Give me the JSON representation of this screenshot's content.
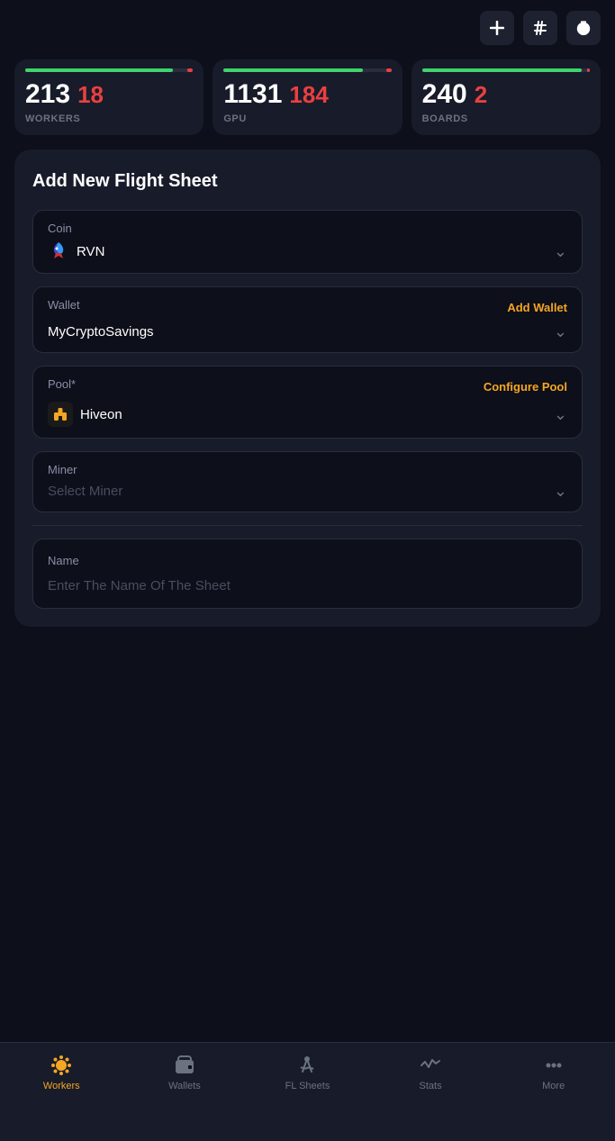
{
  "topbar": {
    "add_label": "+",
    "hash_label": "#",
    "timer_label": "⏱"
  },
  "stats": {
    "workers": {
      "main": "213",
      "alert": "18",
      "label": "WORKERS",
      "bar_green_pct": 88
    },
    "gpu": {
      "main": "1131",
      "alert": "184",
      "label": "GPU",
      "bar_green_pct": 83
    },
    "boards": {
      "main": "240",
      "alert": "2",
      "label": "BOARDS",
      "bar_green_pct": 95
    }
  },
  "form": {
    "title": "Add New Flight Sheet",
    "coin_label": "Coin",
    "coin_value": "RVN",
    "wallet_label": "Wallet",
    "wallet_action": "Add Wallet",
    "wallet_value": "MyCryptoSavings",
    "pool_label": "Pool*",
    "pool_action": "Configure Pool",
    "pool_value": "Hiveon",
    "miner_label": "Miner",
    "miner_placeholder": "Select Miner",
    "name_label": "Name",
    "name_placeholder": "Enter The Name Of The Sheet"
  },
  "bottomnav": {
    "items": [
      {
        "id": "workers",
        "label": "Workers",
        "active": true
      },
      {
        "id": "wallets",
        "label": "Wallets",
        "active": false
      },
      {
        "id": "fl-sheets",
        "label": "FL Sheets",
        "active": false
      },
      {
        "id": "stats",
        "label": "Stats",
        "active": false
      },
      {
        "id": "more",
        "label": "More",
        "active": false
      }
    ]
  }
}
